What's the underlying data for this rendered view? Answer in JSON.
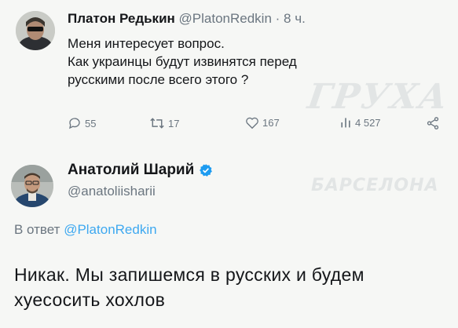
{
  "tweet1": {
    "author_name": "Платон Редькин",
    "author_handle": "@PlatonRedkin",
    "time": "· 8 ч.",
    "lines": [
      "Меня интересует вопрос.",
      "Как украинцы будут извинятся перед",
      "русскими после всего этого ?"
    ],
    "stats": {
      "replies": "55",
      "retweets": "17",
      "likes": "167",
      "views": "4 527"
    }
  },
  "tweet2": {
    "author_name": "Анатолий Шарий",
    "author_handle": "@anatoliisharii",
    "reply_prefix": "В ответ",
    "reply_to": "@PlatonRedkin",
    "lines": [
      "Никак. Мы запишемся в русских и будем",
      "хуесосить хохлов"
    ]
  },
  "watermark": {
    "line1": "ГРУХА",
    "line2": "БАРСЕЛОНА"
  },
  "colors": {
    "background": "#f6f7f5",
    "text": "#141619",
    "muted": "#6b7680",
    "link": "#1d9bf0",
    "verified": "#1d9bf0"
  },
  "icons": [
    "reply-icon",
    "retweet-icon",
    "like-icon",
    "views-icon",
    "share-icon",
    "verified-badge-icon"
  ]
}
